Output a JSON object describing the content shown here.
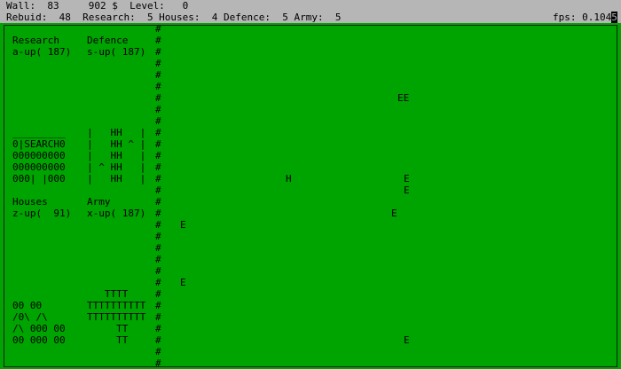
{
  "hud": {
    "line1": "Wall:  83     902 $  Level:   0",
    "line2": "Rebuid:  48  Research:  5 Houses:  4 Defence:  5 Army:  5",
    "fps": "fps: 0.104",
    "cursor": "5"
  },
  "panels": {
    "research": {
      "title": "Research",
      "upgrade": "a-up( 187)"
    },
    "defence": {
      "title": "Defence",
      "upgrade": "s-up( 187)"
    },
    "houses": {
      "title": "Houses",
      "upgrade": "z-up(  91)"
    },
    "army": {
      "title": "Army",
      "upgrade": "x-up( 187)"
    }
  },
  "art": {
    "research": "_________\n0|SEARCH0\n000000000\n000000000\n000| |000",
    "defence": "|   HH   |\n|   HH ^ |\n|   HH   |\n| ^ HH   |\n|   HH   |",
    "houses": "00 00\n/0\\ /\\\n/\\ 000 00\n00 000 00",
    "army": "   TTTT\nTTTTTTTTTT\nTTTTTTTTTT\n     TT\n     TT"
  },
  "wall": "#\n#\n#\n#\n#\n#\n#\n#\n#\n#\n#\n#\n#\n#\n#\n#\n#\n#\n#\n#\n#\n#\n#\n#\n#\n#\n#\n#\n#\n#",
  "field": {
    "hero": "H",
    "enemies": [
      "EE",
      "E",
      "E",
      "E",
      "E",
      "E",
      "E"
    ]
  }
}
